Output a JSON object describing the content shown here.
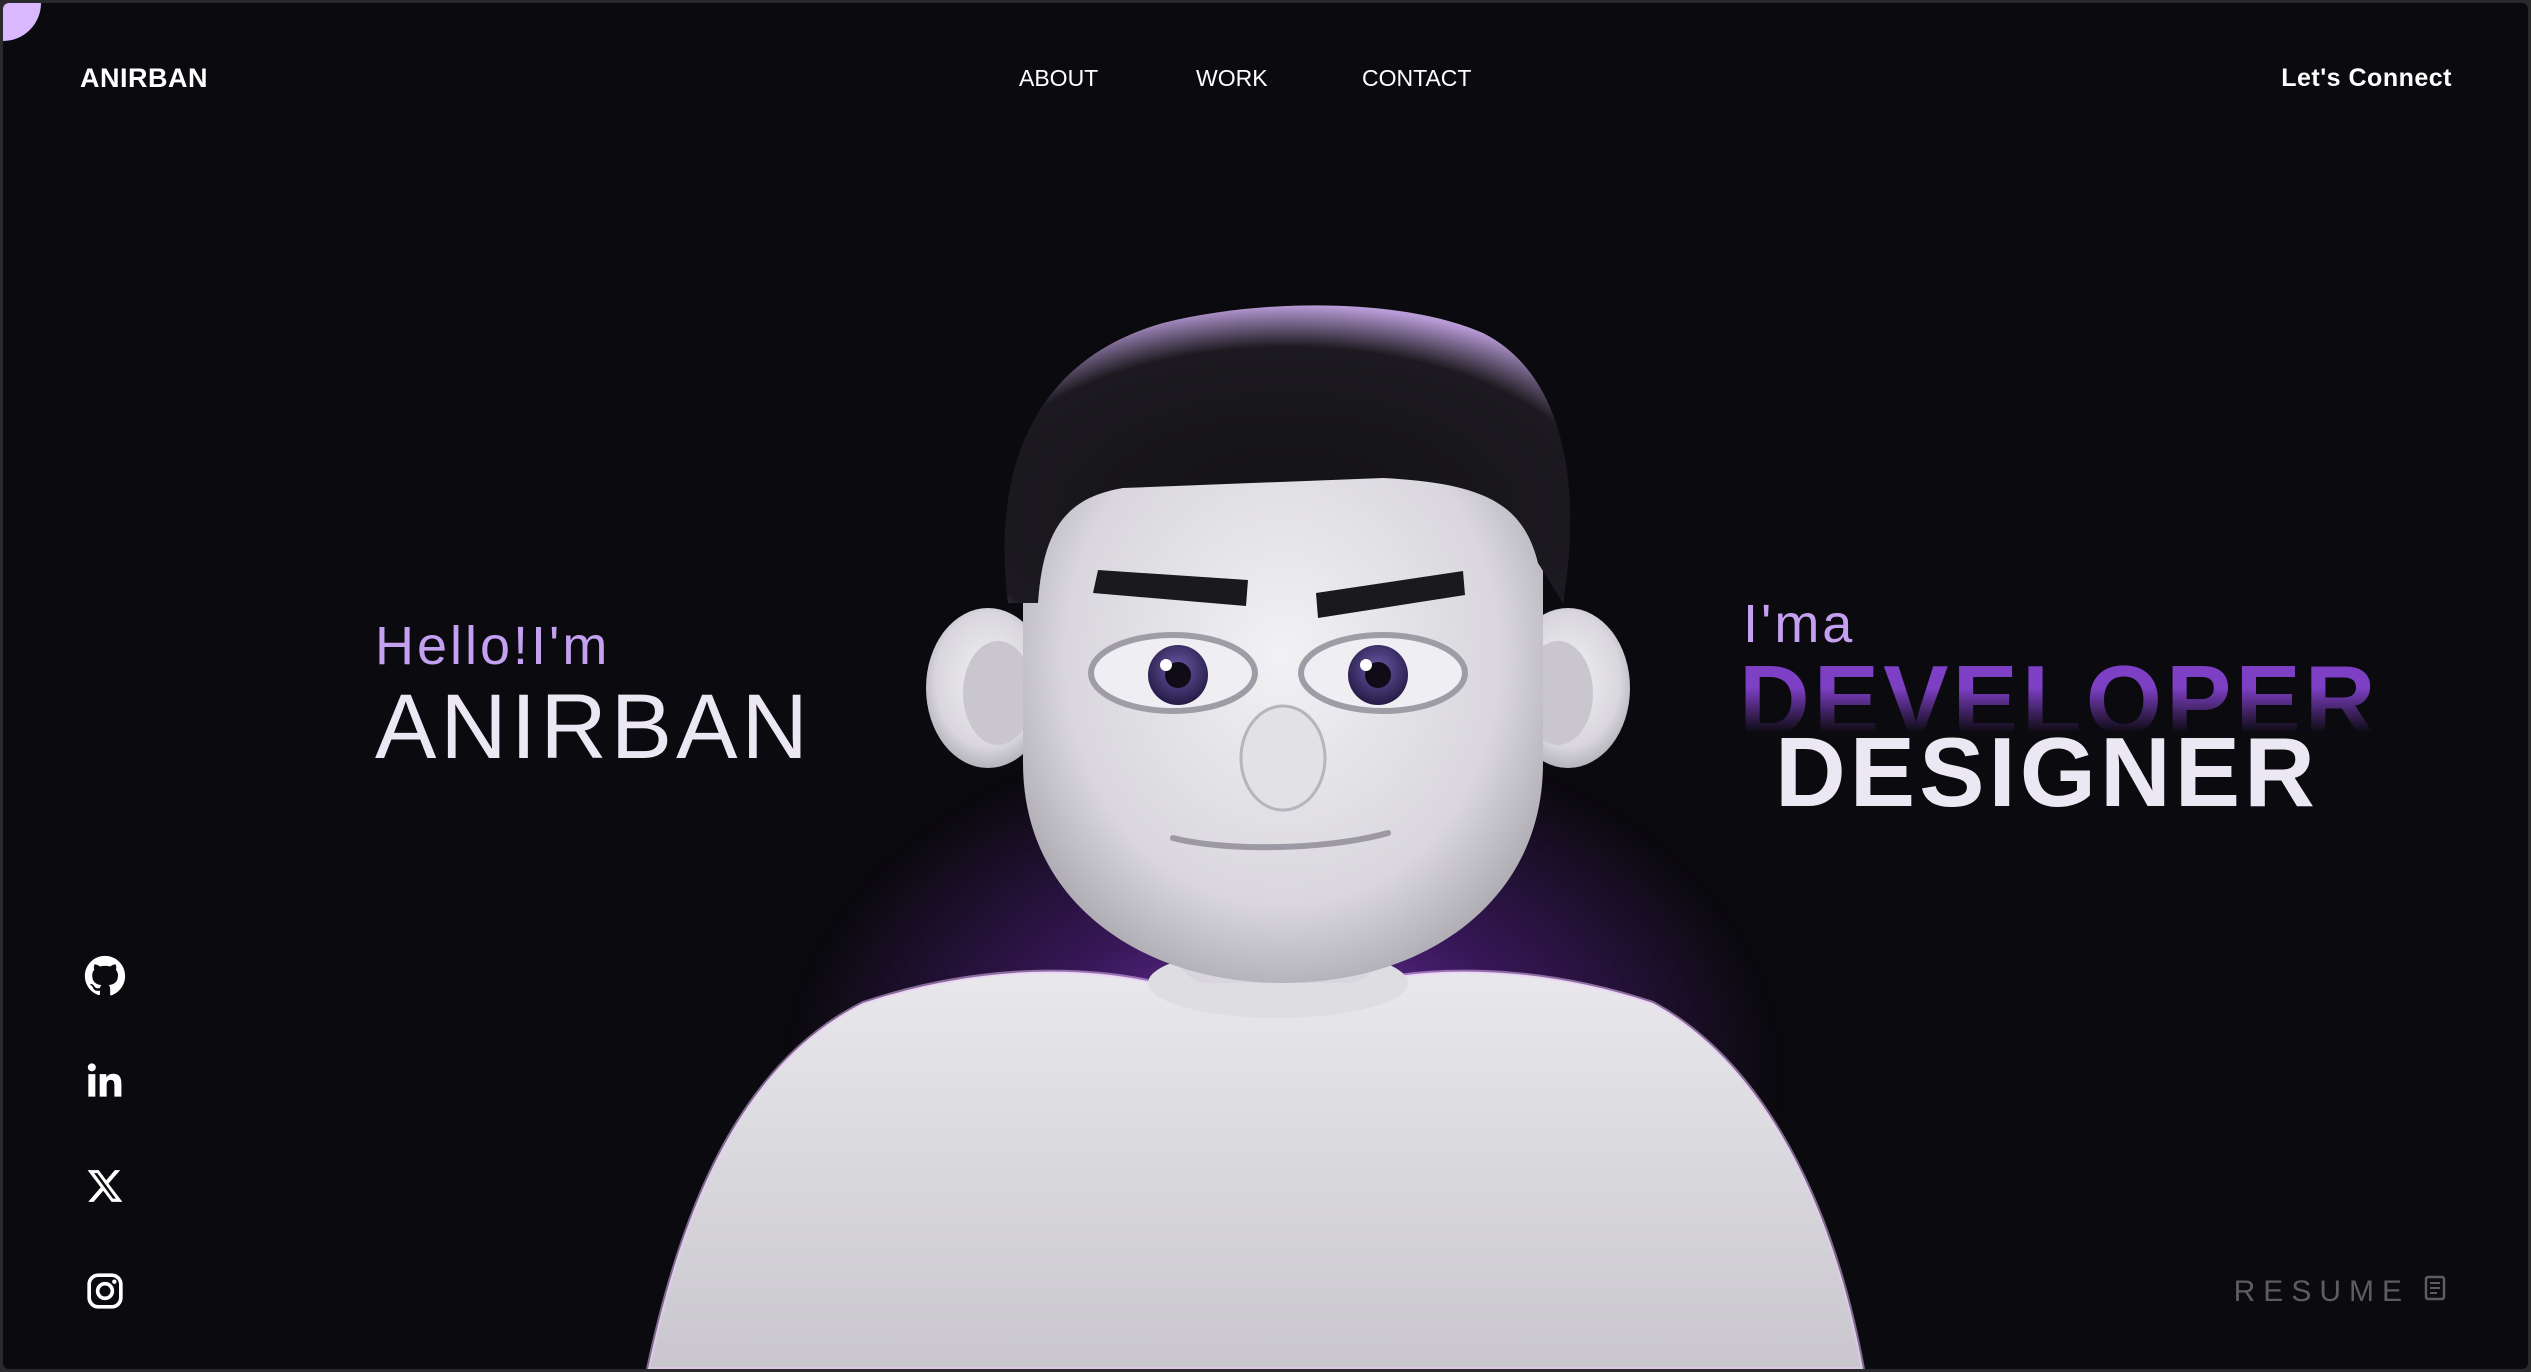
{
  "nav": {
    "logo": "ANIRBAN",
    "links": [
      {
        "label": "ABOUT"
      },
      {
        "label": "WORK"
      },
      {
        "label": "CONTACT"
      }
    ],
    "cta": "Let's Connect"
  },
  "hero": {
    "greeting": "Hello!I'm",
    "name": "ANIRBAN",
    "intro": "I'ma",
    "role_primary": "DEVELOPER",
    "role_secondary": "DESIGNER"
  },
  "social": [
    {
      "icon": "github-icon"
    },
    {
      "icon": "linkedin-icon"
    },
    {
      "icon": "x-twitter-icon"
    },
    {
      "icon": "instagram-icon"
    }
  ],
  "resume": {
    "label": "RESUME",
    "icon": "document-icon"
  },
  "colors": {
    "background": "#0b0a0e",
    "accent": "#c3a0f0",
    "accent_deep": "#7d3fc4",
    "text": "#ffffff",
    "muted": "#5e5b63"
  }
}
